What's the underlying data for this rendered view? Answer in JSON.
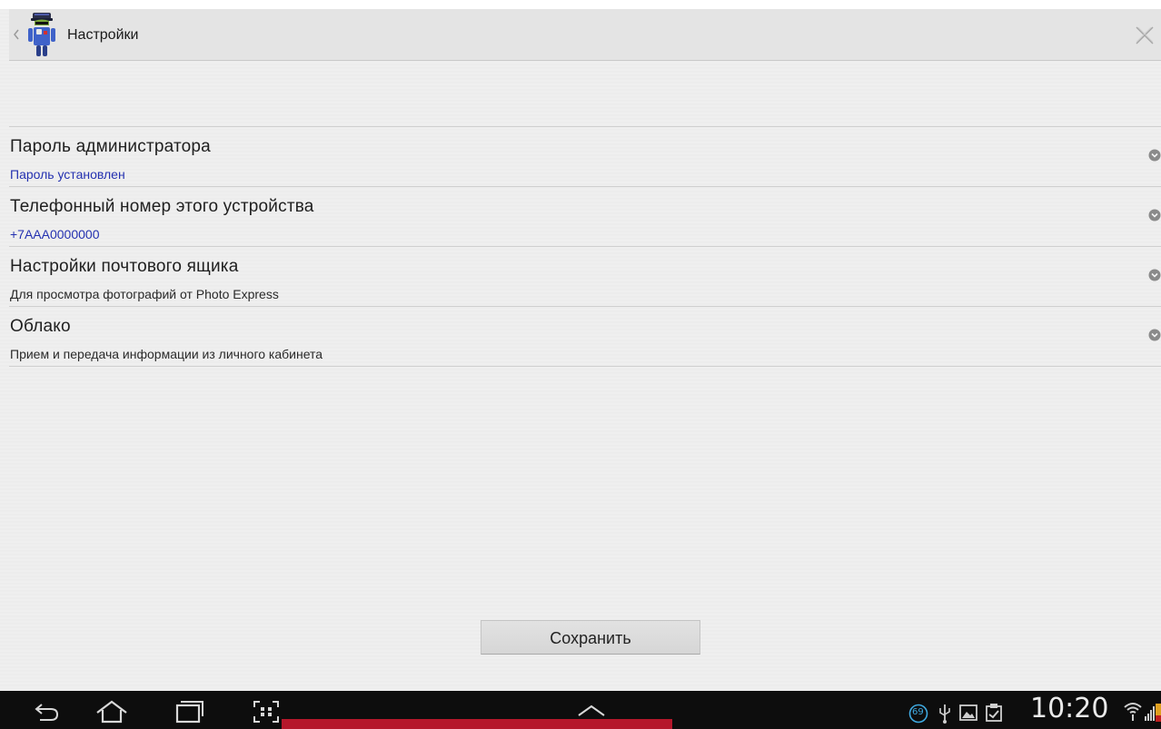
{
  "window": {
    "title": "Настройки"
  },
  "preferences": [
    {
      "title": "Пароль администратора",
      "summary": "Пароль установлен"
    },
    {
      "title": "Телефонный номер этого устройства",
      "summary": "+7AAA0000000"
    },
    {
      "title": "Настройки почтового ящика",
      "summary": "Для просмотра фотографий от Photo Express"
    },
    {
      "title": "Облако",
      "summary": "Прием и передача информации из личного кабинета"
    }
  ],
  "actions": {
    "save_label": "Сохранить"
  },
  "status_bar": {
    "time": "10:20",
    "notification_count": "69"
  },
  "colors": {
    "summary_blue": "#2431b0",
    "system_bar": "#0d0d0d"
  },
  "icons": {
    "back": "chevron-left-icon",
    "app": "android-robot-icon",
    "close": "close-x-icon",
    "pref_arrow": "chevron-down-circle-icon",
    "nav": [
      "back-arrow-icon",
      "home-icon",
      "recent-apps-icon",
      "screenshot-icon",
      "expand-up-icon"
    ],
    "tray": [
      "notification-badge-icon",
      "usb-icon",
      "gallery-icon",
      "clipboard-icon",
      "wifi-icon",
      "signal-icon",
      "battery-icon"
    ]
  }
}
